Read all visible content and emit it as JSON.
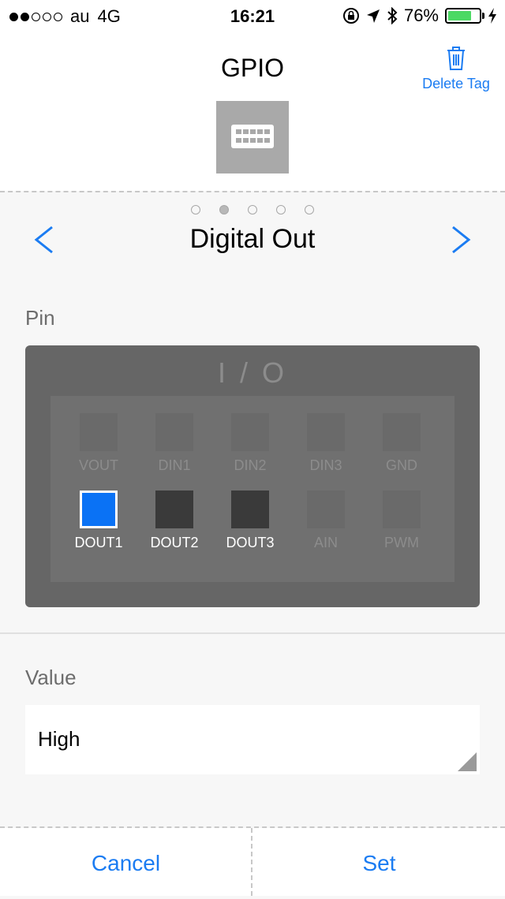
{
  "status_bar": {
    "carrier": "au",
    "network": "4G",
    "time": "16:21",
    "battery_percent": "76%",
    "battery_level": 0.76,
    "signal_bars": [
      true,
      true,
      false,
      false,
      false
    ]
  },
  "header": {
    "title": "GPIO",
    "delete_label": "Delete Tag"
  },
  "pager": {
    "pages": 5,
    "active_index": 1
  },
  "mode": {
    "title": "Digital Out"
  },
  "pin_section": {
    "label": "Pin",
    "panel_title": "I / O",
    "pins": [
      {
        "label": "VOUT",
        "state": "disabled"
      },
      {
        "label": "DIN1",
        "state": "disabled"
      },
      {
        "label": "DIN2",
        "state": "disabled"
      },
      {
        "label": "DIN3",
        "state": "disabled"
      },
      {
        "label": "GND",
        "state": "disabled"
      },
      {
        "label": "DOUT1",
        "state": "selected"
      },
      {
        "label": "DOUT2",
        "state": "available"
      },
      {
        "label": "DOUT3",
        "state": "available"
      },
      {
        "label": "AIN",
        "state": "disabled"
      },
      {
        "label": "PWM",
        "state": "disabled"
      }
    ]
  },
  "value_section": {
    "label": "Value",
    "value": "High"
  },
  "footer": {
    "cancel_label": "Cancel",
    "set_label": "Set"
  },
  "colors": {
    "accent": "#1b7cf2",
    "selected_pin": "#0a72f5",
    "battery": "#4cd964"
  }
}
